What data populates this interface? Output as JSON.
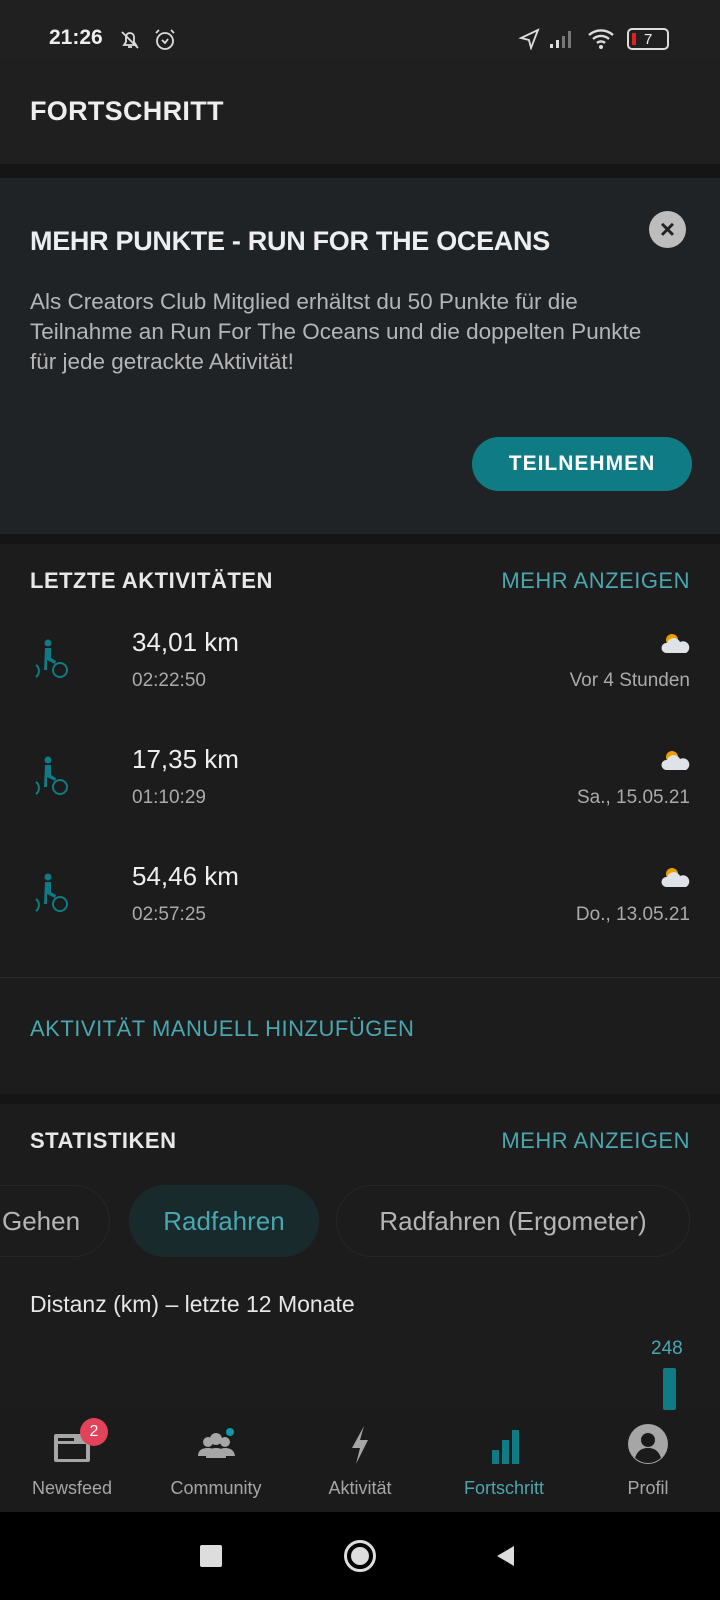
{
  "status_bar": {
    "time": "21:26",
    "battery": "7",
    "icons": [
      "bell-off-icon",
      "alarm-icon",
      "location-icon",
      "signal-icon",
      "wifi-icon",
      "battery-icon"
    ]
  },
  "header": {
    "title": "FORTSCHRITT"
  },
  "banner": {
    "title": "MEHR PUNKTE - RUN FOR THE OCEANS",
    "body": "Als Creators Club Mitglied erhältst du 50 Punkte für die Teilnahme an Run For The Oceans und die doppelten Punkte für jede getrackte Aktivität!",
    "button": "TEILNEHMEN",
    "close": "×"
  },
  "activities": {
    "title": "LETZTE AKTIVITÄTEN",
    "more": "MEHR ANZEIGEN",
    "items": [
      {
        "distance": "34,01 km",
        "duration": "02:22:50",
        "date": "Vor 4 Stunden",
        "icon": "cycling-icon",
        "weather": "partly-cloudy-icon"
      },
      {
        "distance": "17,35 km",
        "duration": "01:10:29",
        "date": "Sa., 15.05.21",
        "icon": "cycling-icon",
        "weather": "partly-cloudy-icon"
      },
      {
        "distance": "54,46 km",
        "duration": "02:57:25",
        "date": "Do., 13.05.21",
        "icon": "cycling-icon",
        "weather": "partly-cloudy-icon"
      }
    ],
    "add_manual": "AKTIVITÄT MANUELL HINZUFÜGEN"
  },
  "statistics": {
    "title": "STATISTIKEN",
    "more": "MEHR ANZEIGEN",
    "chips": [
      "Gehen",
      "Radfahren",
      "Radfahren (Ergometer)"
    ],
    "selected_chip": "Radfahren",
    "chart_title": "Distanz (km) – letzte 12 Monate"
  },
  "chart_data": {
    "type": "bar",
    "title": "Distanz (km) – letzte 12 Monate",
    "values": [
      248
    ],
    "data_labels": [
      "248"
    ],
    "color": "#0f7b84"
  },
  "bottom_nav": {
    "items": [
      {
        "label": "Newsfeed",
        "icon": "newsfeed-icon",
        "badge": "2"
      },
      {
        "label": "Community",
        "icon": "community-icon"
      },
      {
        "label": "Aktivität",
        "icon": "lightning-icon"
      },
      {
        "label": "Fortschritt",
        "icon": "bar-chart-icon",
        "active": true
      },
      {
        "label": "Profil",
        "icon": "profile-icon"
      }
    ]
  },
  "colors": {
    "accent": "#0f7b84",
    "accent_text": "#4aa7b0",
    "badge": "#e0435a"
  }
}
